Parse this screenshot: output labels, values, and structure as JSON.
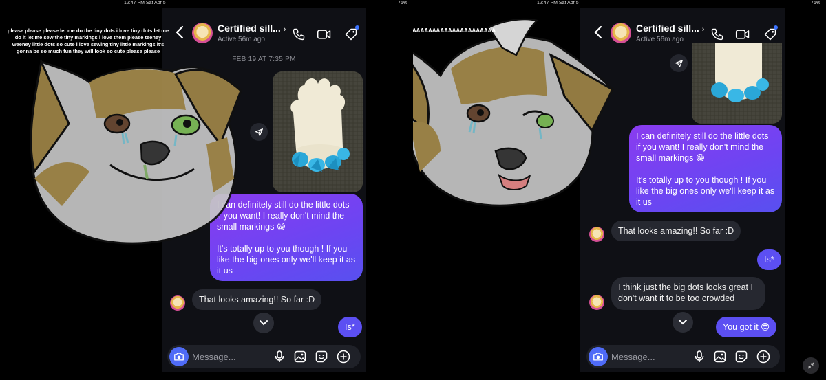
{
  "left": {
    "status": {
      "time": "12:47 PM  Sat Apr 5",
      "battery": "76%"
    },
    "caption": "please please please let me do the tiny dots i love tiny dots let me do it let me sew the tiny markings i love them please teeney weeney little dots so cute i love sewing tiny little markings it's gonna be so much fun they will look so cute please please",
    "header": {
      "name": "Certified sill...",
      "status": "Active 56m ago"
    },
    "timestamp": "FEB 19 AT 7:35 PM",
    "messages": {
      "out1_p1": "I can definitely still do the little dots if you want! I really don't mind the small markings 😁",
      "out1_p2": "It's totally up to you though ! If you like the big ones only we'll keep it as it us",
      "in1": "That looks amazing!! So far :D",
      "out2": "Is*"
    },
    "composer": {
      "placeholder": "Message..."
    }
  },
  "right": {
    "status": {
      "time": "12:47 PM  Sat Apr 5",
      "battery": "76%"
    },
    "caption": "AAAAAAAAAAAAAAAAAAAAAAAAAA",
    "header": {
      "name": "Certified sill...",
      "status": "Active 56m ago"
    },
    "messages": {
      "out1_p1": "I can definitely still do the little dots if you want! I really don't mind the small markings 😁",
      "out1_p2": "It's totally up to you though ! If you like the big ones only we'll keep it as it us",
      "in1": "That looks amazing!! So far :D",
      "out2": "Is*",
      "in2": "I think just the big dots looks great I don't want it to be too crowded",
      "out3": "You got it 😎"
    },
    "composer": {
      "placeholder": "Message..."
    }
  },
  "colors": {
    "bubble_out": "#7a3ff0",
    "bubble_in": "#262830",
    "background": "#0f1015",
    "accent": "#3d74ff"
  },
  "icons": [
    "back-icon",
    "phone-icon",
    "video-icon",
    "tag-icon",
    "share-icon",
    "chevron-down-icon",
    "camera-icon",
    "mic-icon",
    "gallery-icon",
    "sticker-icon",
    "plus-icon",
    "minimize-icon"
  ]
}
